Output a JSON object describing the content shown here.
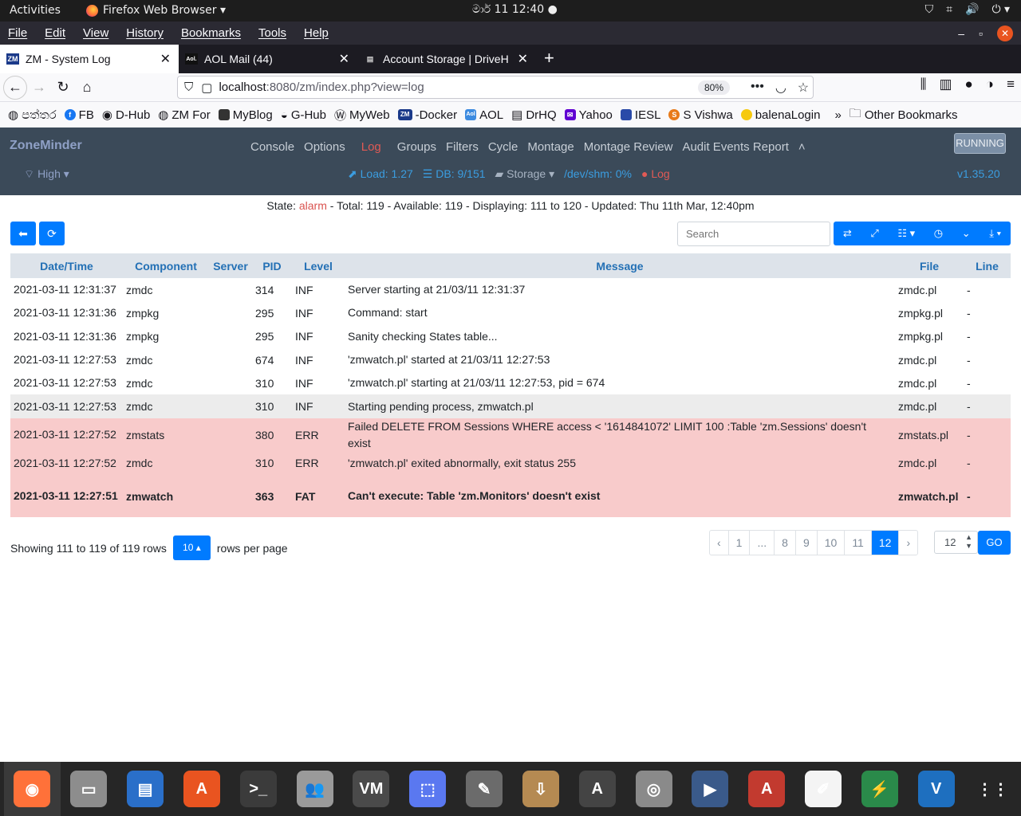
{
  "gnome": {
    "activities": "Activities",
    "app": "Firefox Web Browser ▾",
    "clock": "මාර් 11  12:40",
    "clock_dot": "●"
  },
  "menu": [
    "File",
    "Edit",
    "View",
    "History",
    "Bookmarks",
    "Tools",
    "Help"
  ],
  "tabs": [
    {
      "label": "ZM - System Log",
      "icon": "ZM"
    },
    {
      "label": "AOL Mail (44)",
      "icon": "Aol."
    },
    {
      "label": "Account Storage | DriveH",
      "icon": "▤"
    }
  ],
  "url": {
    "host": "localhost",
    "path": ":8080/zm/index.php?view=log",
    "zoom": "80%"
  },
  "bookmarks": [
    "පත්තර",
    "FB",
    "D-Hub",
    "ZM For",
    "MyBlog",
    "G-Hub",
    "MyWeb",
    "-Docker",
    "AOL",
    "DrHQ",
    "Yahoo",
    "IESL",
    "S Vishwa",
    "balenaLogin"
  ],
  "bookmarks_more": "»",
  "bookmarks_other": "Other Bookmarks",
  "zm": {
    "brand": "ZoneMinder",
    "links": [
      "Console",
      "Options",
      "Log",
      "Groups",
      "Filters",
      "Cycle",
      "Montage",
      "Montage Review",
      "Audit Events Report",
      "˄"
    ],
    "running": "RUNNING",
    "bandwidth": "High ▾",
    "load": "Load: 1.27",
    "db": "DB: 9/151",
    "storage": "Storage ▾",
    "shm": "/dev/shm: 0%",
    "log": "Log",
    "version": "v1.35.20"
  },
  "status": {
    "prefix": "State: ",
    "state": "alarm",
    "rest": " -  Total: 119 -  Available: 119 -  Displaying: 111 to 120 -  Updated: Thu 11th Mar, 12:40pm"
  },
  "search_placeholder": "Search",
  "columns": [
    "Date/Time",
    "Component",
    "Server",
    "PID",
    "Level",
    "Message",
    "File",
    "Line"
  ],
  "rows": [
    {
      "dt": "2021-03-11 12:31:37",
      "comp": "zmdc",
      "server": "",
      "pid": "314",
      "level": "INF",
      "msg": "Server starting at 21/03/11 12:31:37",
      "file": "zmdc.pl",
      "line": "-"
    },
    {
      "dt": "2021-03-11 12:31:36",
      "comp": "zmpkg",
      "server": "",
      "pid": "295",
      "level": "INF",
      "msg": "Command: start",
      "file": "zmpkg.pl",
      "line": "-"
    },
    {
      "dt": "2021-03-11 12:31:36",
      "comp": "zmpkg",
      "server": "",
      "pid": "295",
      "level": "INF",
      "msg": "Sanity checking States table...",
      "file": "zmpkg.pl",
      "line": "-"
    },
    {
      "dt": "2021-03-11 12:27:53",
      "comp": "zmdc",
      "server": "",
      "pid": "674",
      "level": "INF",
      "msg": "'zmwatch.pl' started at 21/03/11 12:27:53",
      "file": "zmdc.pl",
      "line": "-"
    },
    {
      "dt": "2021-03-11 12:27:53",
      "comp": "zmdc",
      "server": "",
      "pid": "310",
      "level": "INF",
      "msg": "'zmwatch.pl' starting at 21/03/11 12:27:53, pid = 674",
      "file": "zmdc.pl",
      "line": "-"
    },
    {
      "dt": "2021-03-11 12:27:53",
      "comp": "zmdc",
      "server": "",
      "pid": "310",
      "level": "INF",
      "msg": "Starting pending process, zmwatch.pl",
      "file": "zmdc.pl",
      "line": "-"
    },
    {
      "dt": "2021-03-11 12:27:52",
      "comp": "zmstats",
      "server": "",
      "pid": "380",
      "level": "ERR",
      "msg": "Failed DELETE FROM Sessions WHERE access < '1614841072' LIMIT 100 :Table 'zm.Sessions' doesn't exist",
      "file": "zmstats.pl",
      "line": "-"
    },
    {
      "dt": "2021-03-11 12:27:52",
      "comp": "zmdc",
      "server": "",
      "pid": "310",
      "level": "ERR",
      "msg": "'zmwatch.pl' exited abnormally, exit status 255",
      "file": "zmdc.pl",
      "line": "-"
    },
    {
      "dt": "2021-03-11 12:27:51",
      "comp": "zmwatch",
      "server": "",
      "pid": "363",
      "level": "FAT",
      "msg": "Can't execute: Table 'zm.Monitors' doesn't exist",
      "file": "zmwatch.pl",
      "line": "-"
    }
  ],
  "pagination": {
    "showing": "Showing 111 to 119 of 119 rows",
    "per_page": "10 ▴",
    "per_page_suffix": "rows per page",
    "pages": [
      "‹",
      "1",
      "...",
      "8",
      "9",
      "10",
      "11",
      "12",
      "›"
    ],
    "current": "12",
    "goto_value": "12",
    "go": "GO"
  },
  "dock": [
    {
      "name": "firefox",
      "color": "#ff7139",
      "glyph": "◉"
    },
    {
      "name": "files",
      "color": "#8d8d8d",
      "glyph": "▭"
    },
    {
      "name": "writer",
      "color": "#2a6fc9",
      "glyph": "▤"
    },
    {
      "name": "software",
      "color": "#e95420",
      "glyph": "A"
    },
    {
      "name": "terminal",
      "color": "#3b3b3b",
      "glyph": ">_"
    },
    {
      "name": "users",
      "color": "#9a9a9a",
      "glyph": "👥"
    },
    {
      "name": "vm",
      "color": "#4a4a4a",
      "glyph": "VM"
    },
    {
      "name": "screenshot",
      "color": "#5a78f0",
      "glyph": "⬚"
    },
    {
      "name": "gimp",
      "color": "#6b6b6b",
      "glyph": "✎"
    },
    {
      "name": "archive",
      "color": "#b58a52",
      "glyph": "⇩"
    },
    {
      "name": "updater",
      "color": "#444",
      "glyph": "A"
    },
    {
      "name": "disks",
      "color": "#8a8a8a",
      "glyph": "◎"
    },
    {
      "name": "video",
      "color": "#3a5a8a",
      "glyph": "▶"
    },
    {
      "name": "dictionary",
      "color": "#c23a2f",
      "glyph": "A"
    },
    {
      "name": "editor",
      "color": "#f4f4f4",
      "glyph": "✐"
    },
    {
      "name": "power",
      "color": "#2a8a4a",
      "glyph": "⚡"
    },
    {
      "name": "vscode",
      "color": "#1e6fbf",
      "glyph": "V"
    },
    {
      "name": "app-grid",
      "color": "#262626",
      "glyph": "⋮⋮"
    }
  ]
}
